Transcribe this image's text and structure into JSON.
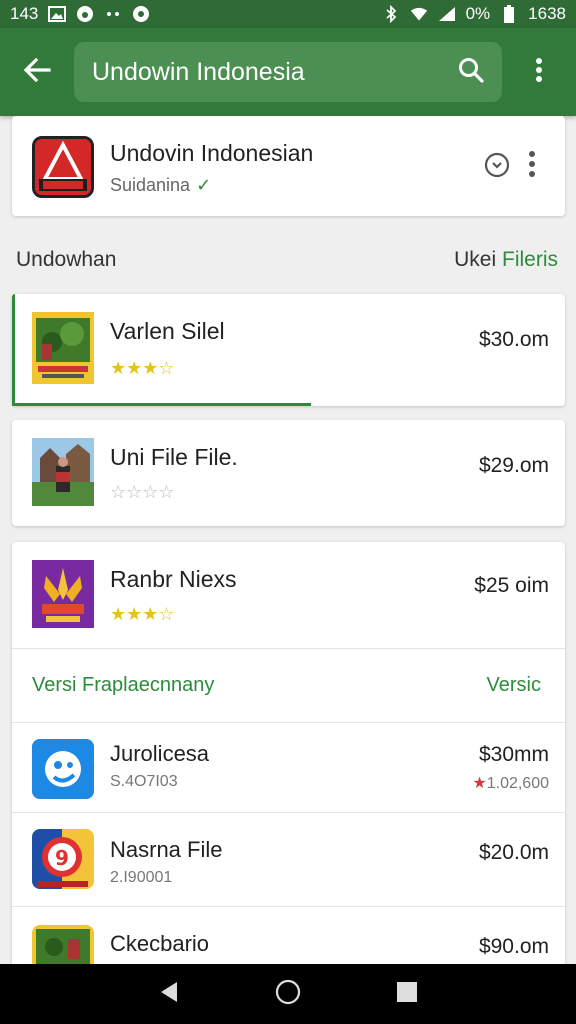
{
  "status_bar": {
    "time": "143",
    "battery": "0%",
    "clock": "1638"
  },
  "app_bar": {
    "search_text": "Undowin Indonesia"
  },
  "app_card": {
    "name": "Undovin Indonesian",
    "subtitle": "Suidanina",
    "verified_mark": "✓"
  },
  "section": {
    "title": "Undowhan",
    "link_prefix": "Ukei",
    "link_accent": "Fileris"
  },
  "items": [
    {
      "name": "Varlen Silel",
      "price": "$30.om",
      "rating": 3.5,
      "stars": "★★★☆",
      "progress": 0.54
    },
    {
      "name": "Uni File File.",
      "price": "$29.om",
      "rating": 0,
      "stars": "☆☆☆☆"
    },
    {
      "name": "Ranbr Niexs",
      "price": "$25 oim",
      "rating": 3,
      "stars": "★★★☆"
    }
  ],
  "sub_header": {
    "left": "Versi Fraplaecnnany",
    "right": "Versic"
  },
  "rows": [
    {
      "name": "Jurolicesa",
      "sub": "S.4O7I03",
      "price": "$30mm",
      "sub_right": "1.02,600",
      "sub_right_star": "★"
    },
    {
      "name": "Nasrna File",
      "sub": "2.I90001",
      "price": "$20.0m",
      "sub_right": "",
      "sub_right_star": ""
    },
    {
      "name": "Ckecbario",
      "sub": "",
      "price": "$90.om",
      "sub_right": "",
      "sub_right_star": ""
    }
  ],
  "colors": {
    "status_bar": "#2e6b35",
    "app_bar": "#327a3a",
    "search_box": "#4c8f52",
    "accent_green": "#2e8b3d",
    "star_yellow": "#e3c41f"
  },
  "icons": {
    "back": "arrow-left-icon",
    "search": "search-icon",
    "overflow": "more-vert-icon",
    "nav_back": "triangle-back-icon",
    "nav_home": "circle-home-icon",
    "nav_recents": "square-recents-icon"
  }
}
